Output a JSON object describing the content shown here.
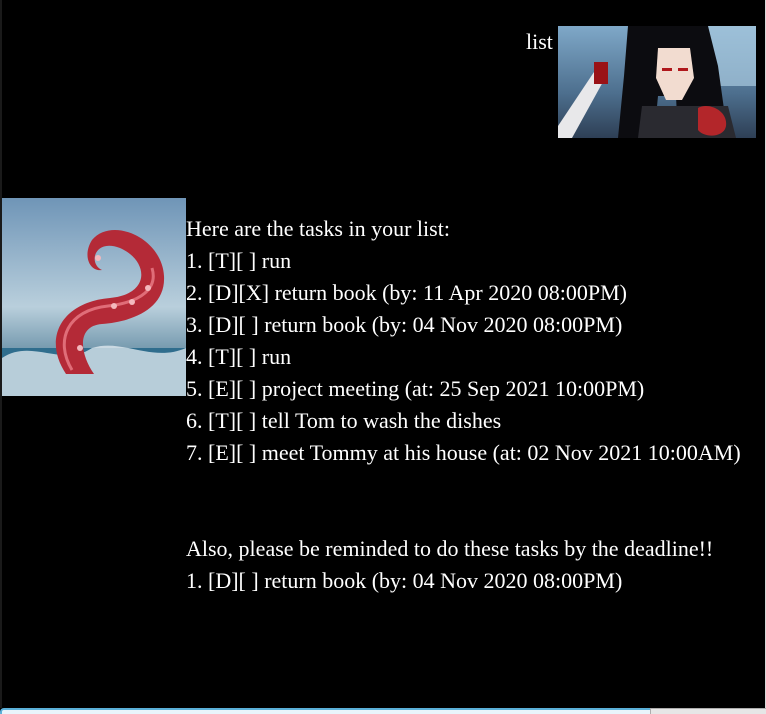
{
  "user_dialog": {
    "text": "list",
    "avatar_icon": "anime-girl-avatar-icon"
  },
  "bot_dialog": {
    "avatar_icon": "tentacle-avatar-icon",
    "lines": [
      "Here are the tasks in your list:",
      "1. [T][ ] run",
      "2. [D][X] return book (by: 11 Apr 2020 08:00PM)",
      "3. [D][ ] return book (by: 04 Nov 2020 08:00PM)",
      "4. [T][ ] run",
      "5. [E][ ] project meeting (at: 25 Sep 2021 10:00PM)",
      "6. [T][ ] tell Tom to wash the dishes",
      "7. [E][ ] meet Tommy at his house (at: 02 Nov 2021 10:00AM)"
    ],
    "reminder_lines": [
      "Also, please be reminded to do these tasks by the deadline!!",
      "1. [D][ ] return book (by: 04 Nov 2020 08:00PM)"
    ]
  },
  "colors": {
    "background": "#000000",
    "text": "#ffffff",
    "input_border": "#5bb0d9"
  }
}
